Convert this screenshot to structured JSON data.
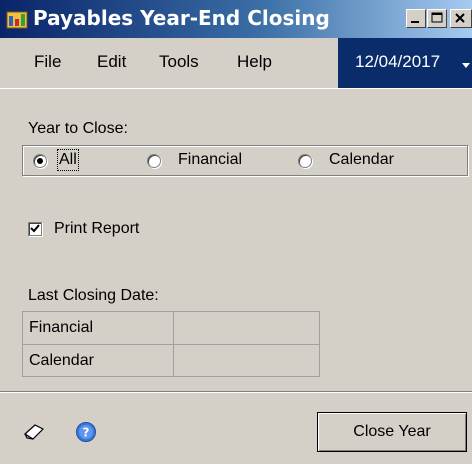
{
  "window": {
    "title": "Payables Year-End Closing"
  },
  "menu": {
    "items": [
      "File",
      "Edit",
      "Tools",
      "Help"
    ],
    "date": "12/04/2017"
  },
  "year_to_close": {
    "label": "Year to Close:",
    "options": [
      "All",
      "Financial",
      "Calendar"
    ],
    "selected": "All"
  },
  "print_report": {
    "label": "Print Report",
    "checked": true
  },
  "last_closing": {
    "label": "Last Closing Date:",
    "rows": [
      {
        "label": "Financial",
        "value": ""
      },
      {
        "label": "Calendar",
        "value": ""
      }
    ]
  },
  "footer": {
    "close_button": "Close Year"
  },
  "icons": {
    "app": "app-icon",
    "note": "note-icon",
    "help": "help-icon"
  },
  "colors": {
    "title_bar": "#0a246a",
    "date_box": "#0b2c6b",
    "face": "#d4d0c8"
  }
}
